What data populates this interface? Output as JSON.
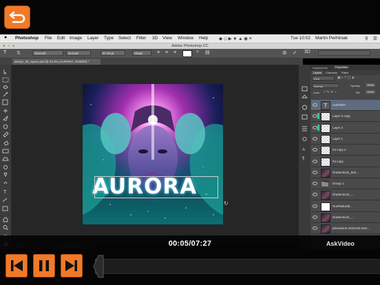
{
  "player": {
    "time": "00:05/07:27",
    "brand": "AskVideo",
    "progress_fraction": 0.011,
    "accent": "#f07a28"
  },
  "menubar": {
    "apple": "",
    "app": "Photoshop",
    "items": [
      "File",
      "Edit",
      "Image",
      "Layer",
      "Type",
      "Select",
      "Filter",
      "3D",
      "View",
      "Window",
      "Help"
    ],
    "clock": "Tue 10:02",
    "user": "Martin Perhiniak"
  },
  "photoshop": {
    "window_title": "Adobe Photoshop CC",
    "options": {
      "font_family": "Serecah",
      "font_style": "Normal",
      "font_size": "57.84 pt",
      "antialias": "Sharp"
    },
    "document_tab": "design_06_space.psd @ 33.3% (AURORA, RGB/8#) *",
    "canvas_text": "AURORA",
    "status_zoom": "33.33%",
    "status_doc": "Doc: 5.74M/27.5M"
  },
  "panel": {
    "top_tabs": [
      "Adjustments",
      "Properties"
    ],
    "tabs": [
      "Layers",
      "Channels",
      "Paths"
    ],
    "kind": "Kind",
    "blend": "Normal",
    "opacity_label": "Opacity:",
    "opacity": "100%",
    "lock_label": "Lock:",
    "fill_label": "Fill:",
    "fill": "100%",
    "layers": [
      {
        "name": "AURORA",
        "thumb": "type",
        "selected": true
      },
      {
        "name": "Layer 2 copy",
        "thumb": "transparent"
      },
      {
        "name": "Layer 2",
        "thumb": "transparent"
      },
      {
        "name": "Layer 1",
        "thumb": "transparent"
      },
      {
        "name": "04 copy 2",
        "thumb": "transparent"
      },
      {
        "name": "04 copy",
        "thumb": "transparent"
      },
      {
        "name": "shutterstock_604...",
        "thumb": "photo"
      },
      {
        "name": "Group 1",
        "thumb": "folder"
      },
      {
        "name": "shutterstock_...",
        "thumb": "photo"
      },
      {
        "name": "Hue/Saturati...",
        "thumb": "adjust"
      },
      {
        "name": "shutterstock_...",
        "thumb": "photo"
      },
      {
        "name": "photodune-1621146-man...",
        "thumb": "photo"
      }
    ]
  }
}
